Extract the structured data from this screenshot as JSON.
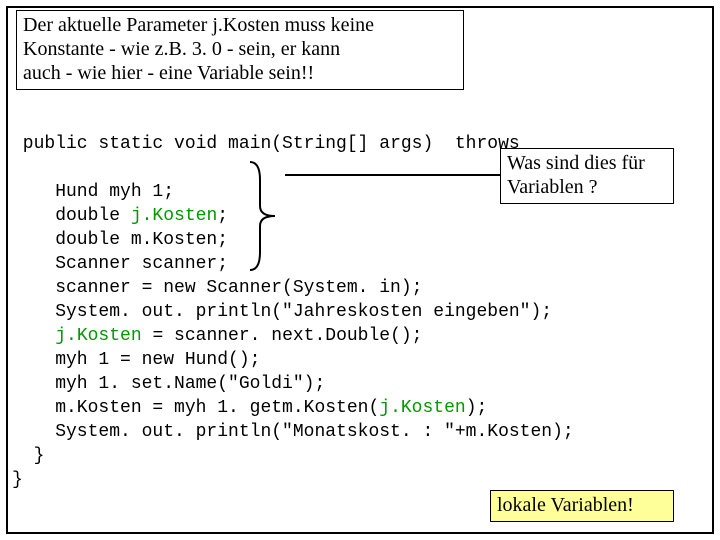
{
  "tooltip_top": {
    "line1": "Der aktuelle Parameter j.Kosten muss keine",
    "line2": "Konstante - wie z.B. 3. 0 - sein, er kann",
    "line3": "auch - wie hier - eine Variable sein!!"
  },
  "callout_right": {
    "line1": "Was sind dies für",
    "line2": "Variablen ?"
  },
  "answer": "lokale Variablen!",
  "code": {
    "l1a": " public static void main(String[]",
    "l1b": " args)  throws",
    "l2": "",
    "l3": "    Hund myh 1;",
    "l4a": "    double ",
    "l4b": "j.Kosten",
    "l4c": ";",
    "l5": "    double m.Kosten;",
    "l6": "    Scanner scanner;",
    "l7": "    scanner = new Scanner(System. in);",
    "l8": "    System. out. println(\"Jahreskosten eingeben\");",
    "l9a": "    ",
    "l9b": "j.Kosten",
    "l9c": " = scanner. next.Double();",
    "l10": "    myh 1 = new Hund();",
    "l11": "    myh 1. set.Name(\"Goldi\");",
    "l12a": "    m.Kosten = myh 1. getm.Kosten(",
    "l12b": "j.Kosten",
    "l12c": ");",
    "l13": "    System. out. println(\"Monatskost. : \"+m.Kosten);",
    "l14": "  }",
    "l15": "}"
  }
}
